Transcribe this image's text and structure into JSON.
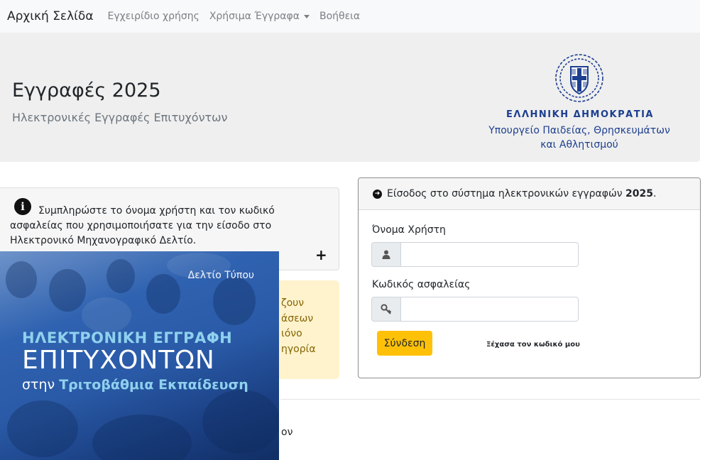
{
  "nav": {
    "brand": "Αρχική Σελίδα",
    "links": [
      "Εγχειρίδιο χρήσης",
      "Χρήσιμα Έγγραφα",
      "Βοήθεια"
    ]
  },
  "header": {
    "title": "Εγγραφές 2025",
    "subtitle": "Ηλεκτρονικές Εγγραφές Επιτυχόντων",
    "gov_title": "ΕΛΛΗΝΙΚΗ ΔΗΜΟΚΡΑΤΙΑ",
    "gov_sub_1": "Υπουργείο Παιδείας, Θρησκευμάτων",
    "gov_sub_2": "και Αθλητισμού"
  },
  "info": {
    "text": "Συμπληρώστε το όνομα χρήστη και τον κωδικό ασφαλείας που χρησιμοποιήσατε για την είσοδο στο Ηλεκτρονικό Μηχανογραφικό Δελτίο.",
    "expand_symbol": "+"
  },
  "warning": {
    "fragments": [
      "ζουν",
      "άσεων",
      "ιόνο",
      "ηγορία"
    ]
  },
  "bottom_fragment": "ον",
  "login": {
    "header_prefix": "Είσοδος στο σύστημα ηλεκτρονικών εγγραφών",
    "header_year": "2025",
    "username_label": "Όνομα Χρήστη",
    "username_value": "",
    "password_label": "Κωδικός ασφαλείας",
    "password_value": "",
    "submit_label": "Σύνδεση",
    "forgot_label": "Ξέχασα τον κωδικό μου"
  },
  "banner": {
    "press": "Δελτίο Τύπου",
    "line1": "ΗΛΕΚΤΡΟΝΙΚΗ ΕΓΓΡΑΦΗ",
    "line2": "ΕΠΙΤΥΧΟΝΤΩΝ",
    "line3_prefix": "στην",
    "line3_bold": "Τριτοβάθμια Εκπαίδευση"
  },
  "icons": {
    "emblem": "greek-state-emblem",
    "info": "info-circle-icon",
    "arrow": "arrow-circle-right-icon",
    "user": "user-icon",
    "key": "key-icon",
    "plus": "plus-icon"
  },
  "colors": {
    "navbar_bg": "#f8f9fa",
    "jumbotron_bg": "#efefef",
    "gov_blue": "#1d3f8f",
    "submit_btn": "#ffc107",
    "warning_bg": "#fff3cd",
    "banner_blue": "#2a5aa7",
    "banner_accent": "#8fd1ee"
  }
}
